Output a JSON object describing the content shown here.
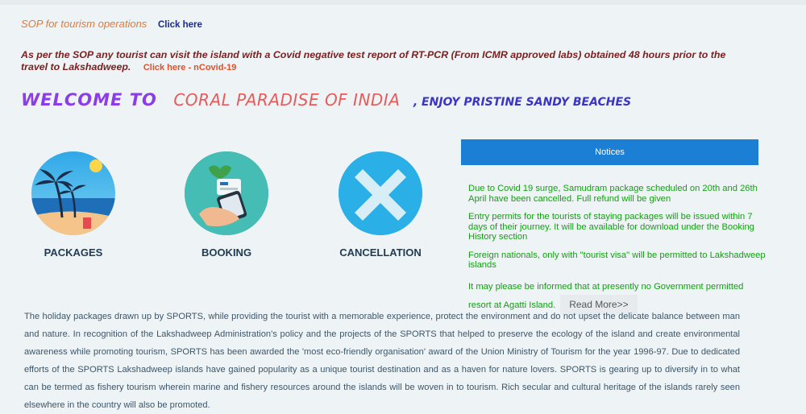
{
  "sop": {
    "text": "SOP for tourism operations",
    "link": "Click here"
  },
  "notice_line": {
    "text": "As per the SOP any tourist can visit the island with a Covid negative test report of RT-PCR (From ICMR approved labs) obtained 48 hours prior to the travel to Lakshadweep.",
    "link": "Click here - nCovid-19"
  },
  "welcome": {
    "part1": "WELCOME TO",
    "part2": "CORAL PARADISE OF INDIA",
    "part3": ", ENJOY PRISTINE SANDY BEACHES"
  },
  "services": [
    {
      "label": "PACKAGES",
      "icon": "beach-palm-icon"
    },
    {
      "label": "BOOKING",
      "icon": "hand-phone-booking-icon"
    },
    {
      "label": "CANCELLATION",
      "icon": "x-cancel-icon"
    }
  ],
  "notices": {
    "title": "Notices",
    "items": [
      "Due to Covid 19 surge, Samudram package scheduled on 20th and 26th April have been cancelled. Full refund will be given",
      "Entry permits for the tourists of staying packages will be issued within 7 days of their journey. It will be available for download under the Booking History section",
      "Foreign nationals, only with \"tourist visa\" will be permitted to Lakshadweep islands",
      "It may please be informed that at presently no Government permitted resort at Agatti Island."
    ],
    "read_more": "Read More>>"
  },
  "description": "The holiday packages drawn up by SPORTS, while providing the tourist with a memorable experience, protect the environment and do not upset the delicate balance between man and nature. In recognition of the Lakshadweep Administration's policy and the projects of the SPORTS that helped to preserve the ecology of the island and create environmental awareness while promoting tourism, SPORTS has been awarded the 'most eco-friendly organisation' award of the Union Ministry of Tourism for the year 1996-97. Due to dedicated efforts of the SPORTS Lakshadweep islands have gained popularity as a unique tourist destination and as a haven for nature lovers. SPORTS is gearing up to diversify in to what can be termed as fishery tourism wherein marine and fishery resources around the islands will be woven in to tourism. Rich secular and cultural heritage of the islands rarely seen elsewhere in the country will also be promoted.",
  "colors": {
    "notices_header": "#1c7fd6",
    "notices_text": "#14a014",
    "welcome_purple": "#8a3de8",
    "welcome_coral": "#e85a5a",
    "welcome_blue": "#3a34c8"
  }
}
